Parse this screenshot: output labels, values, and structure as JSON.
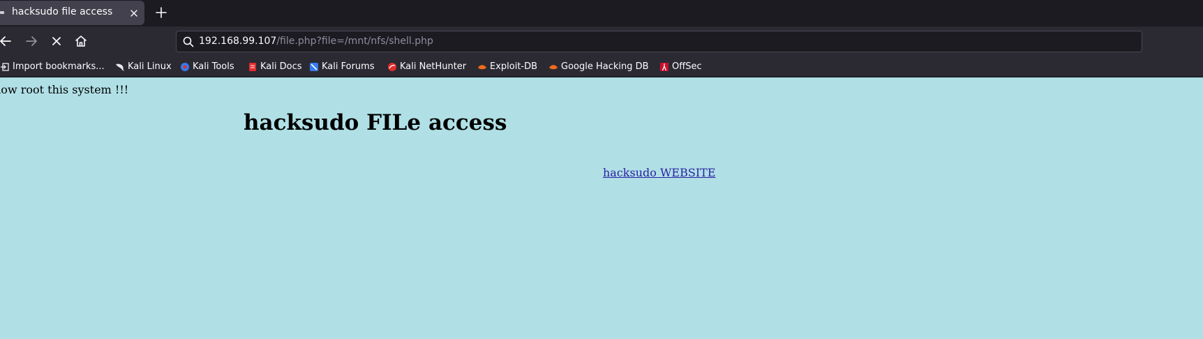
{
  "browser": {
    "tab": {
      "title": "hacksudo file access"
    },
    "url": {
      "host": "192.168.99.107",
      "path": "/file.php?file=/mnt/nfs/shell.php"
    },
    "bookmarks": [
      {
        "label": "Import bookmarks...",
        "icon": "import-icon"
      },
      {
        "label": "Kali Linux",
        "icon": "kali-dragon-icon"
      },
      {
        "label": "Kali Tools",
        "icon": "kali-tools-icon"
      },
      {
        "label": "Kali Docs",
        "icon": "kali-docs-icon"
      },
      {
        "label": "Kali Forums",
        "icon": "kali-forums-icon"
      },
      {
        "label": "Kali NetHunter",
        "icon": "kali-nethunter-icon"
      },
      {
        "label": "Exploit-DB",
        "icon": "exploit-db-icon"
      },
      {
        "label": "Google Hacking DB",
        "icon": "google-hacking-db-icon"
      },
      {
        "label": "OffSec",
        "icon": "offsec-icon"
      }
    ],
    "colors": {
      "tabstrip": "#1c1b22",
      "toolbar": "#2b2a33",
      "page_background": "#b0e0e6",
      "link": "#2a1ea0"
    }
  },
  "page": {
    "note": "now root this system !!!",
    "heading": "hacksudo FILe access",
    "link_text": "hacksudo WEBSITE"
  }
}
